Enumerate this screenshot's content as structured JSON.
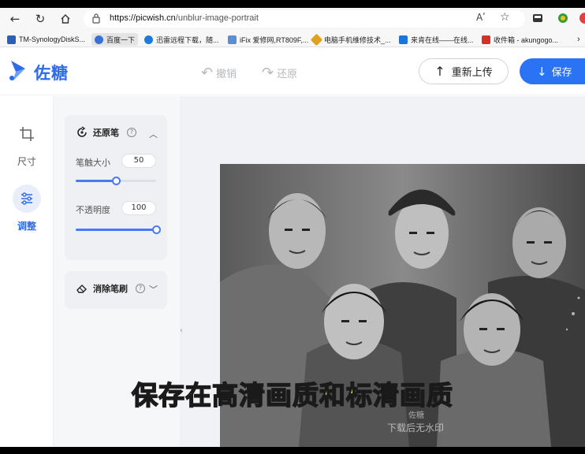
{
  "browser": {
    "url_host": "https://picwish.cn",
    "url_path": "/unblur-image-portrait",
    "read_aloud_label": "Aʹ"
  },
  "bookmarks": [
    {
      "label": "TM-SynologyDiskS...",
      "color": "#2b5fb8"
    },
    {
      "label": "百度一下",
      "color": "#3a6fd8"
    },
    {
      "label": "迅雷远程下载，随...",
      "color": "#1a7be0"
    },
    {
      "label": "iFix 爱修网,RT809F,...",
      "color": "#5a8fd0"
    },
    {
      "label": "电脑手机维修技术_...",
      "color": "#e0a020"
    },
    {
      "label": "来肯在线——在线...",
      "color": "#1677d9"
    },
    {
      "label": "收件箱 - akungogo...",
      "color": "#d93025"
    }
  ],
  "app": {
    "brand": "佐糖",
    "undo_label": "撤销",
    "redo_label": "还原",
    "reupload_label": "重新上传",
    "save_label": "保存"
  },
  "rail": [
    {
      "label": "尺寸",
      "active": false
    },
    {
      "label": "调整",
      "active": true
    }
  ],
  "panel": {
    "restore_brush": {
      "title": "还原笔",
      "brush_size_label": "笔触大小",
      "brush_size_value": "50",
      "brush_size_fraction": 0.5,
      "opacity_label": "不透明度",
      "opacity_value": "100",
      "opacity_fraction": 1.0
    },
    "erase_brush": {
      "title": "消除笔刷"
    }
  },
  "canvas": {
    "collapse_glyph": "‹",
    "watermark_small": "佐糖",
    "watermark": "下载后无水印"
  },
  "caption": "保存在高清画质和标清画质",
  "colors": {
    "accent": "#2a73f5",
    "slider": "#4a78f0",
    "caption": "#ffe64d"
  }
}
